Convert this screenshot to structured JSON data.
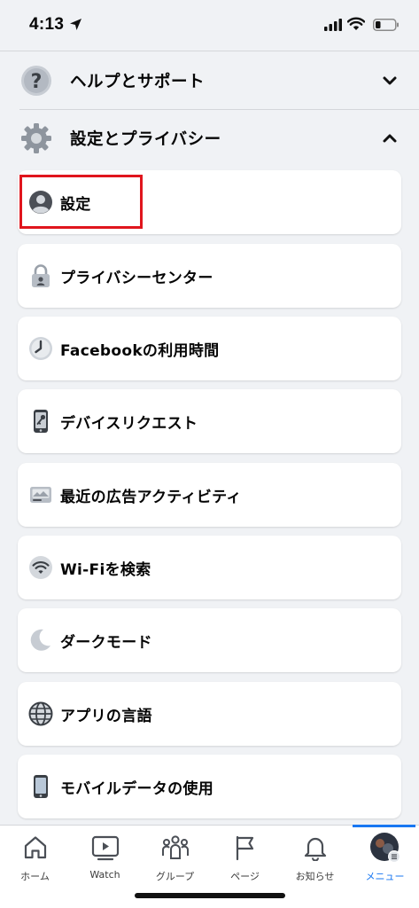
{
  "status_bar": {
    "time": "4:13"
  },
  "sections": {
    "help": {
      "label": "ヘルプとサポート",
      "icon": "question-icon"
    },
    "settings_privacy": {
      "label": "設定とプライバシー",
      "icon": "gear-icon"
    }
  },
  "menu_items": [
    {
      "label": "設定",
      "icon": "account-icon"
    },
    {
      "label": "プライバシーセンター",
      "icon": "lock-icon"
    },
    {
      "label": "Facebookの利用時間",
      "icon": "clock-icon"
    },
    {
      "label": "デバイスリクエスト",
      "icon": "phone-key-icon"
    },
    {
      "label": "最近の広告アクティビティ",
      "icon": "ad-activity-icon"
    },
    {
      "label": "Wi-Fiを検索",
      "icon": "wifi-icon"
    },
    {
      "label": "ダークモード",
      "icon": "moon-icon"
    },
    {
      "label": "アプリの言語",
      "icon": "globe-icon"
    },
    {
      "label": "モバイルデータの使用",
      "icon": "mobile-icon"
    }
  ],
  "tabs": [
    {
      "label": "ホーム",
      "icon": "home-icon"
    },
    {
      "label": "Watch",
      "icon": "watch-icon"
    },
    {
      "label": "グループ",
      "icon": "groups-icon"
    },
    {
      "label": "ページ",
      "icon": "flag-icon"
    },
    {
      "label": "お知らせ",
      "icon": "bell-icon"
    },
    {
      "label": "メニュー",
      "icon": "menu-avatar-icon",
      "active": true
    }
  ],
  "colors": {
    "accent": "#1877f2",
    "highlight": "#e0151d",
    "background": "#f0f2f5"
  }
}
